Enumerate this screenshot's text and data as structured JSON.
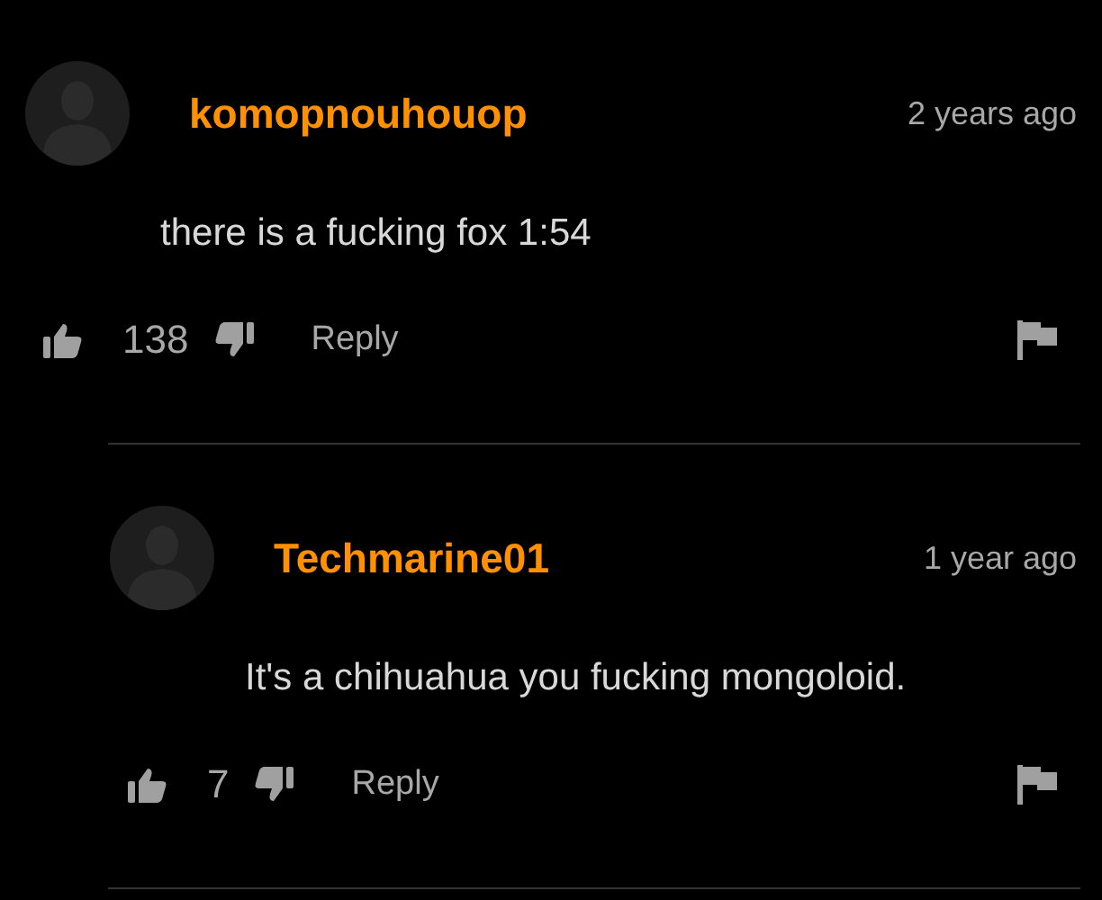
{
  "comments": [
    {
      "author": "komopnouhouop",
      "time": "2 years ago",
      "text": "there is a fucking fox 1:54",
      "likes": "138",
      "reply_label": "Reply",
      "replies": [
        {
          "author": "Techmarine01",
          "time": "1 year ago",
          "text": "It's a chihuahua you fucking mongoloid.",
          "likes": "7",
          "reply_label": "Reply"
        }
      ]
    }
  ]
}
